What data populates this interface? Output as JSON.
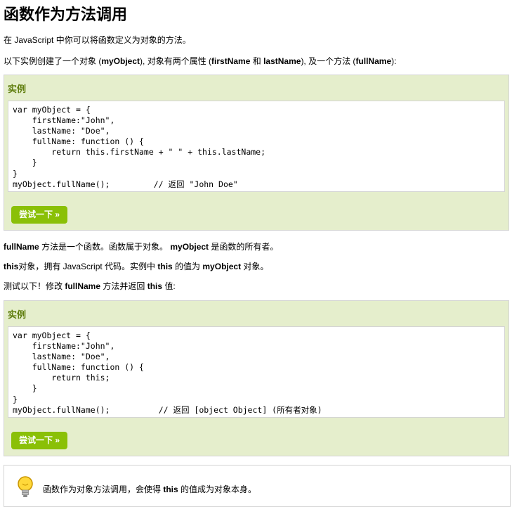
{
  "title": "函数作为方法调用",
  "intro": "在 JavaScript 中你可以将函数定义为对象的方法。",
  "desc": {
    "t1": "以下实例创建了一个对象 (",
    "b1": "myObject",
    "t2": "), 对象有两个属性 (",
    "b2": "firstName",
    "t3": " 和 ",
    "b3": "lastName",
    "t4": "), 及一个方法 (",
    "b4": "fullName",
    "t5": "):"
  },
  "example1": {
    "label": "实例",
    "code": "var myObject = {\n    firstName:\"John\",\n    lastName: \"Doe\",\n    fullName: function () {\n        return this.firstName + \" \" + this.lastName;\n    }\n}\nmyObject.fullName();         // 返回 \"John Doe\"",
    "button": "尝试一下 »"
  },
  "note1": {
    "b1": "fullName",
    "t1": " 方法是一个函数。函数属于对象。 ",
    "b2": "myObject",
    "t2": " 是函数的所有者。"
  },
  "note2": {
    "b1": "this",
    "t1": "对象，拥有 JavaScript 代码。实例中 ",
    "b2": "this",
    "t2": " 的值为 ",
    "b3": "myObject",
    "t3": " 对象。"
  },
  "note3": {
    "t1": "测试以下！修改 ",
    "b1": "fullName",
    "t2": " 方法并返回 ",
    "b2": "this",
    "t3": " 值:"
  },
  "example2": {
    "label": "实例",
    "code": "var myObject = {\n    firstName:\"John\",\n    lastName: \"Doe\",\n    fullName: function () {\n        return this;\n    }\n}\nmyObject.fullName();          // 返回 [object Object] (所有者对象)",
    "button": "尝试一下 »"
  },
  "tip": {
    "icon": "lightbulb-icon",
    "t1": "函数作为对象方法调用，会使得 ",
    "b1": "this",
    "t2": " 的值成为对象本身。"
  },
  "colors": {
    "example_bg": "#e5eecc",
    "example_title": "#617f10",
    "button_bg": "#8ac007"
  }
}
